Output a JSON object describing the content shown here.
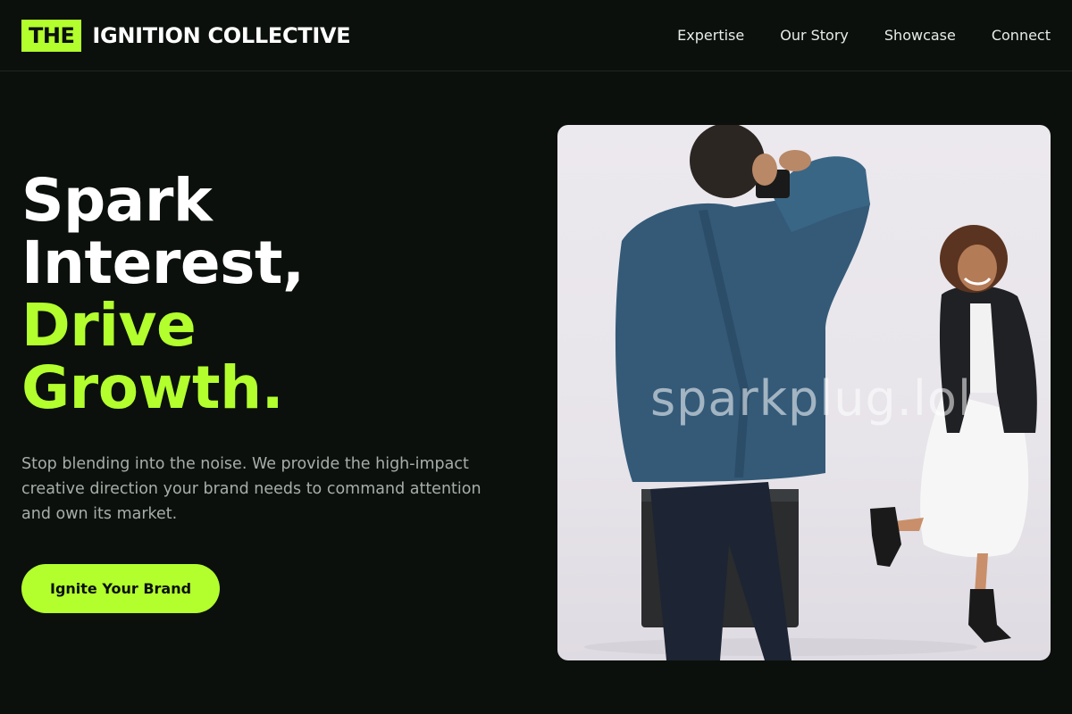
{
  "header": {
    "logo_mark": "THE",
    "logo_name": "IGNITION COLLECTIVE",
    "nav": [
      {
        "label": "Expertise"
      },
      {
        "label": "Our Story"
      },
      {
        "label": "Showcase"
      },
      {
        "label": "Connect"
      }
    ]
  },
  "hero": {
    "headline_line1": "Spark",
    "headline_line2": "Interest,",
    "headline_line3": "Drive",
    "headline_line4": "Growth.",
    "subtext": "Stop blending into the noise. We provide the high-impact creative direction your brand needs to command attention and own its market.",
    "cta_label": "Ignite Your Brand"
  },
  "image": {
    "watermark": "sparkplug.lol"
  },
  "colors": {
    "background": "#0b100c",
    "accent": "#b3ff2e",
    "muted_text": "#a7aea8"
  }
}
